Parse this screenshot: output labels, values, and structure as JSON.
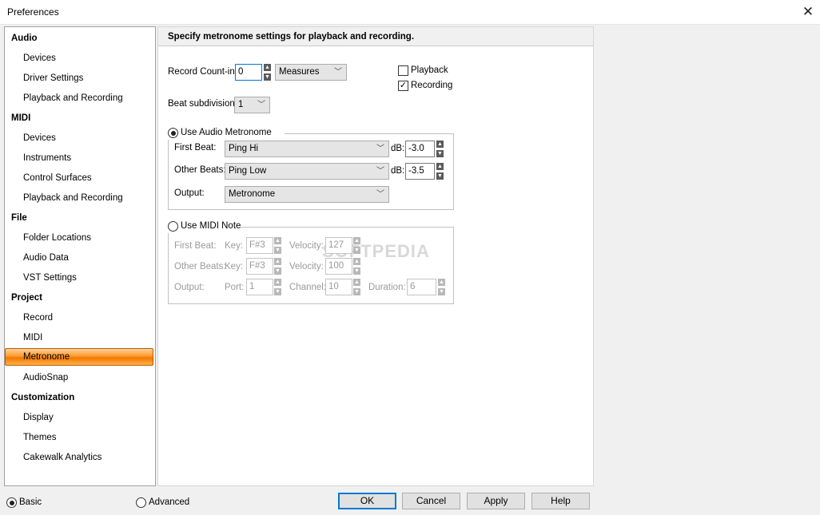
{
  "window": {
    "title": "Preferences"
  },
  "sidebar": {
    "categories": [
      "Audio",
      "MIDI",
      "File",
      "Project",
      "Customization"
    ],
    "audio_items": [
      "Devices",
      "Driver Settings",
      "Playback and Recording"
    ],
    "midi_items": [
      "Devices",
      "Instruments",
      "Control Surfaces",
      "Playback and Recording"
    ],
    "file_items": [
      "Folder Locations",
      "Audio Data",
      "VST Settings"
    ],
    "project_items": [
      "Record",
      "MIDI",
      "Metronome",
      "AudioSnap"
    ],
    "customization_items": [
      "Display",
      "Themes",
      "Cakewalk Analytics"
    ],
    "selected": "Metronome"
  },
  "panel": {
    "header": "Specify metronome settings for playback and recording.",
    "record_countin_label": "Record Count-in:",
    "record_countin_value": "0",
    "countin_unit": "Measures",
    "playback_label": "Playback",
    "recording_label": "Recording",
    "playback_checked": false,
    "recording_checked": true,
    "beat_subdivision_label": "Beat subdivision:",
    "beat_subdivision_value": "1",
    "audio_metronome": {
      "label": "Use Audio Metronome",
      "selected": true,
      "first_beat_label": "First Beat:",
      "first_beat_value": "Ping Hi",
      "first_db_label": "dB:",
      "first_db_value": "-3.0",
      "other_beats_label": "Other Beats:",
      "other_beats_value": "Ping Low",
      "other_db_label": "dB:",
      "other_db_value": "-3.5",
      "output_label": "Output:",
      "output_value": "Metronome"
    },
    "midi_note": {
      "label": "Use MIDI Note",
      "selected": false,
      "first_beat_label": "First Beat:",
      "other_beats_label": "Other Beats:",
      "output_label": "Output:",
      "key_label": "Key:",
      "first_key": "F#3",
      "other_key": "F#3",
      "velocity_label": "Velocity:",
      "first_velocity": "127",
      "other_velocity": "100",
      "port_label": "Port:",
      "port_value": "1",
      "channel_label": "Channel:",
      "channel_value": "10",
      "duration_label": "Duration:",
      "duration_value": "6"
    }
  },
  "footer": {
    "basic_label": "Basic",
    "advanced_label": "Advanced",
    "basic_selected": true,
    "ok_label": "OK",
    "cancel_label": "Cancel",
    "apply_label": "Apply",
    "help_label": "Help"
  },
  "icons": {
    "close": "close-icon",
    "spin": "spin-arrows-icon",
    "dropdown": "chevron-down-icon",
    "check": "checkmark-icon"
  },
  "colors": {
    "selection": "#ff9a2e",
    "default_button_border": "#0078d7"
  }
}
